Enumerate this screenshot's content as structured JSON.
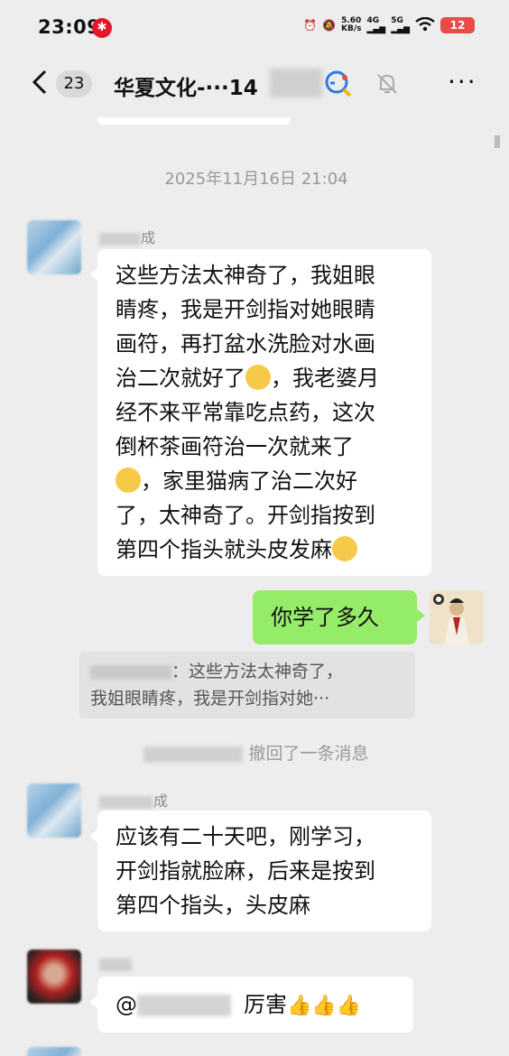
{
  "status_bar": {
    "time": "23:09",
    "weibo_icon": "weibo-icon",
    "net_speed_value": "5.60",
    "net_speed_unit": "KB/s",
    "signal1": "4G",
    "signal2": "5G",
    "battery": "12"
  },
  "header": {
    "unread_count": "23",
    "title": "华夏文化-···14"
  },
  "chat": {
    "timestamp": "2025年11月16日 21:04",
    "messages": [
      {
        "sender": "成",
        "text_lines": [
          "这些方法太神奇了，我姐眼",
          "睛疼，我是开剑指对她眼睛",
          "画符，再打盆水洗脸对水画",
          "治二次就好了",
          "，我老婆月",
          "经不来平常靠吃点药，这次",
          "倒杯茶画符治一次就来了",
          "，家里猫病了治二次好",
          "了，太神奇了。开剑指按到",
          "第四个指头就头皮发麻"
        ]
      },
      {
        "text": "你学了多久"
      },
      {
        "quote_suffix": "：这些方法太神奇了，",
        "quote_line2": "我姐眼睛疼，我是开剑指对她···"
      },
      {
        "recall_text": "撤回了一条消息"
      },
      {
        "sender": "成",
        "text_lines": [
          "应该有二十天吧，刚学习，",
          "开剑指就脸麻，后来是按到",
          "第四个指头，头皮麻"
        ]
      },
      {
        "mention_prefix": "@",
        "text": "厉害"
      }
    ]
  }
}
